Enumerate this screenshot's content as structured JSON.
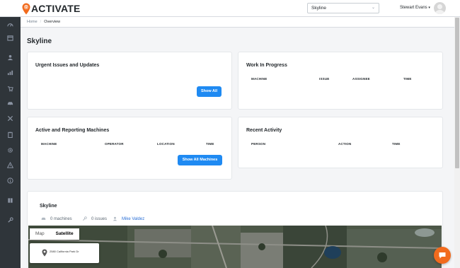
{
  "brand": {
    "name": "ACTIVATE",
    "accent": "#f26b1d"
  },
  "sidebar": {
    "icons": [
      "speedometer-icon",
      "calendar-icon",
      "user-icon",
      "chart-icon",
      "cart-icon",
      "car-icon",
      "tools-icon",
      "clipboard-icon",
      "gear-icon",
      "warning-icon",
      "info-icon",
      "book-icon",
      "wrench-icon"
    ]
  },
  "header": {
    "site_select": "Skyline",
    "user_name": "Stewart Evans"
  },
  "breadcrumb": {
    "home": "Home",
    "current": "Overview"
  },
  "page": {
    "title": "Skyline"
  },
  "cards": {
    "urgent": {
      "title": "Urgent Issues and Updates",
      "button": "Show All"
    },
    "wip": {
      "title": "Work In Progress",
      "columns": [
        "MACHINE",
        "ISSUE",
        "ASSIGNEE",
        "TIME"
      ]
    },
    "machines": {
      "title": "Active and Reporting Machines",
      "columns": [
        "MACHINE",
        "OPERATOR",
        "LOCATION",
        "TIME"
      ],
      "button": "Show All Machines"
    },
    "activity": {
      "title": "Recent Activity",
      "columns": [
        "PERSON",
        "ACTION",
        "TIME"
      ]
    }
  },
  "site_card": {
    "title": "Skyline",
    "machines": "0 machines",
    "issues": "0 issues",
    "manager": "Mike Valdez"
  },
  "map": {
    "tabs": [
      "Map",
      "Satellite"
    ],
    "active_tab": "Satellite",
    "address": "2580 California Park Dr"
  },
  "colors": {
    "primary_button": "#1f8af2",
    "sidebar": "#2f353a",
    "chat": "#f26b1d"
  }
}
